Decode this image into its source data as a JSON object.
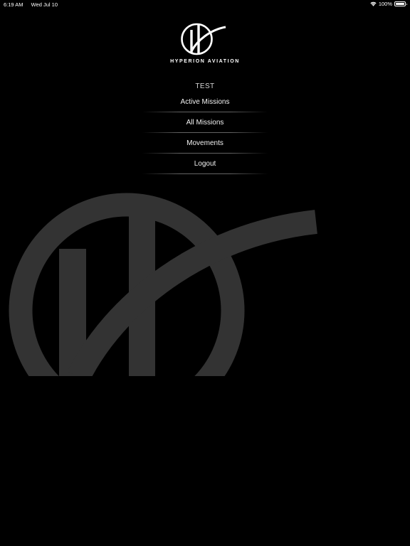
{
  "status_bar": {
    "time": "6:19 AM",
    "date": "Wed Jul 10",
    "battery": "100%",
    "battery_level": 1.0
  },
  "brand": {
    "name": "HYPERION AVIATION",
    "logo_color": "#ffffff",
    "watermark_color": "#333333"
  },
  "menu": {
    "user_label": "TEST",
    "items": [
      {
        "label": "Active Missions"
      },
      {
        "label": "All Missions"
      },
      {
        "label": "Movements"
      },
      {
        "label": "Logout"
      }
    ]
  },
  "icons": [
    "wifi-icon",
    "battery-icon",
    "hyperion-logo-icon",
    "hyperion-watermark-icon"
  ]
}
